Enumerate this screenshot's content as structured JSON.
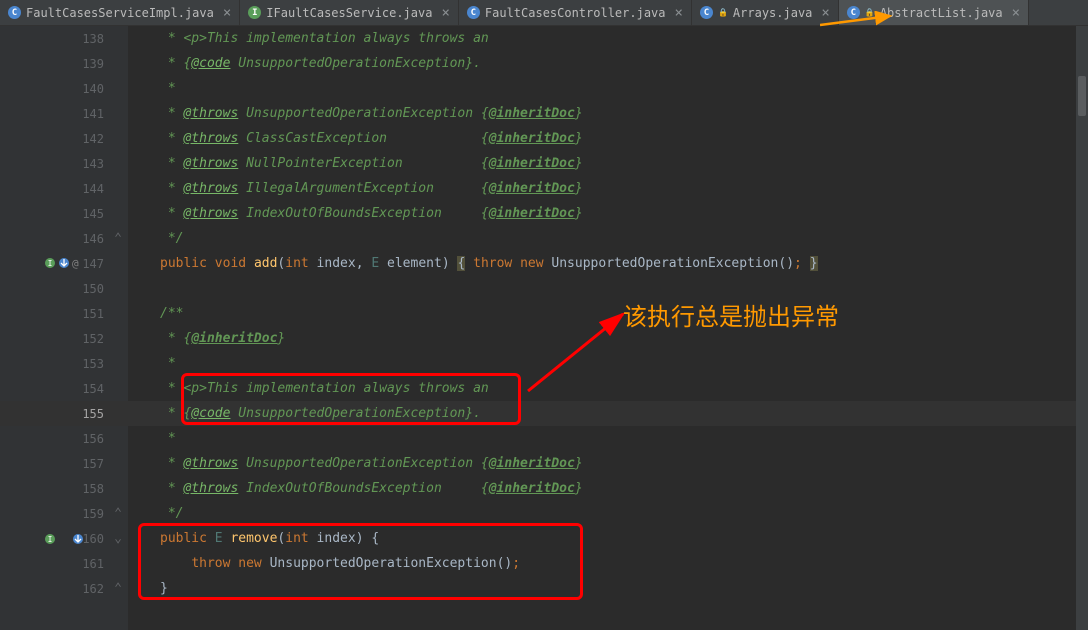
{
  "tabs": [
    {
      "label": "FaultCasesServiceImpl.java",
      "icon": "C",
      "iconType": "c"
    },
    {
      "label": "IFaultCasesService.java",
      "icon": "I",
      "iconType": "i"
    },
    {
      "label": "FaultCasesController.java",
      "icon": "C",
      "iconType": "c"
    },
    {
      "label": "Arrays.java",
      "icon": "C",
      "iconType": "c",
      "locked": true
    },
    {
      "label": "AbstractList.java",
      "icon": "C",
      "iconType": "c",
      "locked": true,
      "active": true
    }
  ],
  "lines": {
    "l138": {
      "num": "138",
      "star": " * ",
      "t1": "<p>This implementation always throws an"
    },
    "l139": {
      "num": "139",
      "star": " * ",
      "t1": "{",
      "t2": "@code",
      "t3": " UnsupportedOperationException}."
    },
    "l140": {
      "num": "140",
      "star": " *"
    },
    "l141": {
      "num": "141",
      "star": " * ",
      "tag": "@throws",
      "t1": " UnsupportedOperationException {",
      "inh": "@inheritDoc",
      "t2": "}"
    },
    "l142": {
      "num": "142",
      "star": " * ",
      "tag": "@throws",
      "t1": " ClassCastException            {",
      "inh": "@inheritDoc",
      "t2": "}"
    },
    "l143": {
      "num": "143",
      "star": " * ",
      "tag": "@throws",
      "t1": " NullPointerException          {",
      "inh": "@inheritDoc",
      "t2": "}"
    },
    "l144": {
      "num": "144",
      "star": " * ",
      "tag": "@throws",
      "t1": " IllegalArgumentException      {",
      "inh": "@inheritDoc",
      "t2": "}"
    },
    "l145": {
      "num": "145",
      "star": " * ",
      "tag": "@throws",
      "t1": " IndexOutOfBoundsException     {",
      "inh": "@inheritDoc",
      "t2": "}"
    },
    "l146": {
      "num": "146",
      "star": " */"
    },
    "l147": {
      "num": "147",
      "kw1": "public",
      "kw2": "void",
      "method": "add",
      "p1": "(",
      "kw3": "int",
      "t1": " index, ",
      "gen": "E",
      "t2": " element",
      "p2": ")",
      "sp": " ",
      "b1": "{",
      "kw4": " throw",
      "kw5": " new",
      "cls": " UnsupportedOperationException",
      "p3": "()",
      "sc": ";",
      "sp2": " ",
      "b2": "}"
    },
    "l150": {
      "num": "150"
    },
    "l151": {
      "num": "151",
      "star": "/**"
    },
    "l152": {
      "num": "152",
      "star": " * ",
      "t1": "{",
      "inh": "@inheritDoc",
      "t2": "}"
    },
    "l153": {
      "num": "153",
      "star": " *"
    },
    "l154": {
      "num": "154",
      "star": " * ",
      "t1": "<p>This implementation always throws an"
    },
    "l155": {
      "num": "155",
      "star": " * ",
      "t1": "{",
      "t2": "@code",
      "t3": " UnsupportedOperationException}."
    },
    "l156": {
      "num": "156",
      "star": " *"
    },
    "l157": {
      "num": "157",
      "star": " * ",
      "tag": "@throws",
      "t1": " UnsupportedOperationException {",
      "inh": "@inheritDoc",
      "t2": "}"
    },
    "l158": {
      "num": "158",
      "star": " * ",
      "tag": "@throws",
      "t1": " IndexOutOfBoundsException     {",
      "inh": "@inheritDoc",
      "t2": "}"
    },
    "l159": {
      "num": "159",
      "star": " */"
    },
    "l160": {
      "num": "160",
      "kw1": "public",
      "gen": "E",
      "method": "remove",
      "p1": "(",
      "kw3": "int",
      "t1": " index",
      "p2": ")",
      "sp": " ",
      "b1": "{"
    },
    "l161": {
      "num": "161",
      "kw4": "throw",
      "kw5": " new",
      "cls": " UnsupportedOperationException",
      "p3": "()",
      "sc": ";"
    },
    "l162": {
      "num": "162",
      "b2": "}"
    }
  },
  "annotation": {
    "text": "该执行总是抛出异常"
  }
}
